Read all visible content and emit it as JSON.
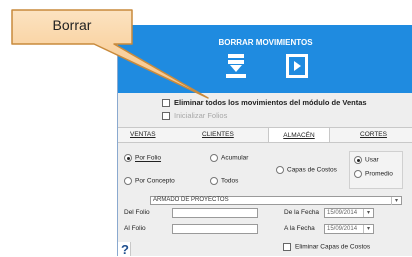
{
  "callout": {
    "text": "Borrar"
  },
  "header": {
    "title": "BORRAR MOVIMIENTOS",
    "brand_color": "#1f8be0"
  },
  "options": {
    "delete_all": "Eliminar todos los movimientos del módulo de Ventas",
    "init_folios": "Inicializar Folios"
  },
  "tabs": [
    "VENTAS",
    "CLIENTES",
    "ALMACÉN",
    "CORTES"
  ],
  "active_tab": "ALMACÉN",
  "filters": {
    "by_folio": "Por Folio",
    "by_concept": "Por Concepto",
    "accumulate": "Acumular",
    "all": "Todos",
    "cost_layers": "Capas de Costos",
    "use": "Usar",
    "average": "Promedio"
  },
  "warehouse": {
    "value": "ARMADO DE PROYECTOS"
  },
  "range": {
    "from_folio_label": "Del Folio",
    "to_folio_label": "Al Folio",
    "from_date_label": "De la Fecha",
    "to_date_label": "A la Fecha",
    "from_date": "15/09/2014",
    "to_date": "15/09/2014"
  },
  "delete_cost_layers": "Eliminar Capas de Costos",
  "help": "?"
}
